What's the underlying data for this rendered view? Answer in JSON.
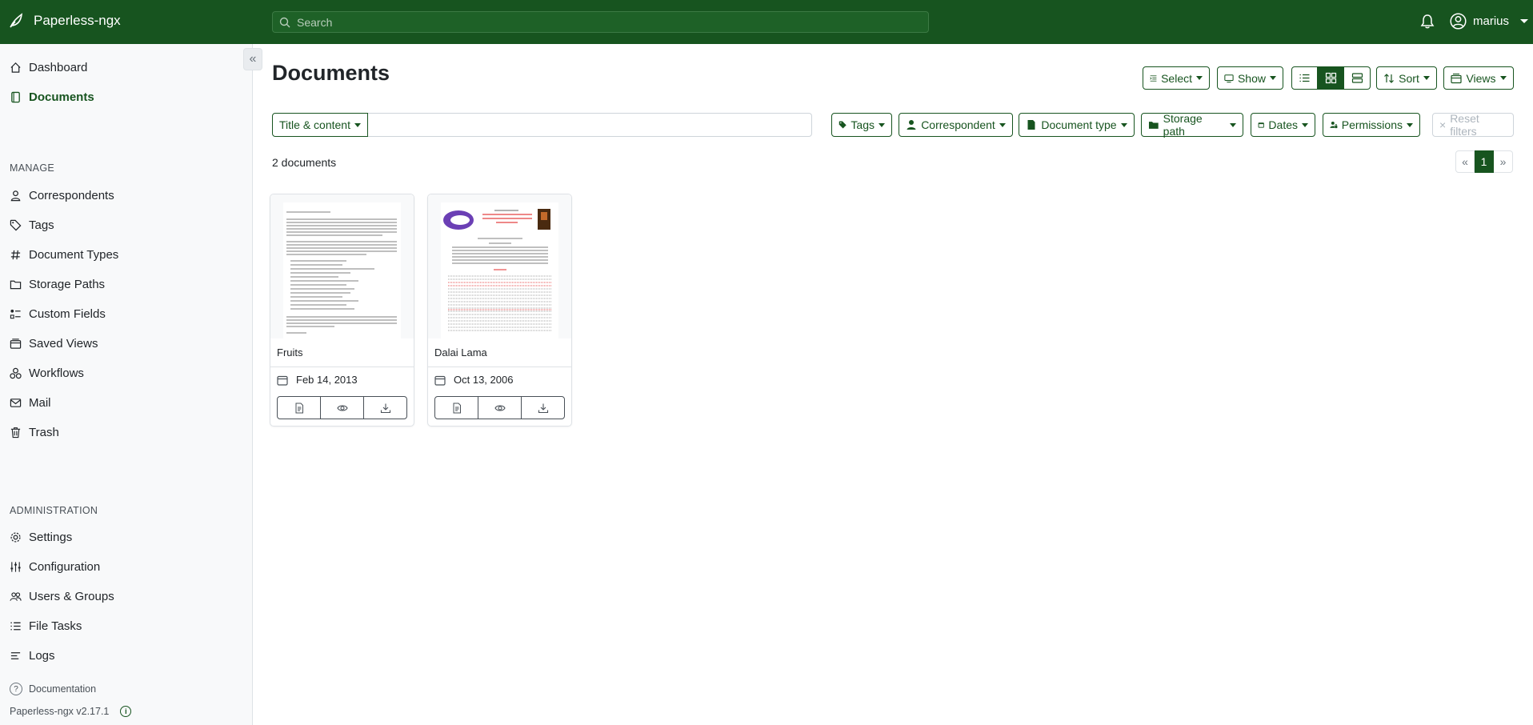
{
  "topbar": {
    "app_name": "Paperless-ngx",
    "search_placeholder": "Search",
    "username": "marius"
  },
  "sidebar": {
    "main_items": [
      {
        "label": "Dashboard",
        "icon": "house-icon"
      },
      {
        "label": "Documents",
        "icon": "file-icon",
        "active": true
      }
    ],
    "manage_label": "MANAGE",
    "manage_items": [
      {
        "label": "Correspondents",
        "icon": "person-icon"
      },
      {
        "label": "Tags",
        "icon": "tag-icon"
      },
      {
        "label": "Document Types",
        "icon": "hash-icon"
      },
      {
        "label": "Storage Paths",
        "icon": "folder-icon"
      },
      {
        "label": "Custom Fields",
        "icon": "ui-radios-icon"
      },
      {
        "label": "Saved Views",
        "icon": "window-stack-icon"
      },
      {
        "label": "Workflows",
        "icon": "boxes-icon"
      },
      {
        "label": "Mail",
        "icon": "envelope-icon"
      },
      {
        "label": "Trash",
        "icon": "trash-icon"
      }
    ],
    "admin_label": "ADMINISTRATION",
    "admin_items": [
      {
        "label": "Settings",
        "icon": "gear-icon"
      },
      {
        "label": "Configuration",
        "icon": "sliders-icon"
      },
      {
        "label": "Users & Groups",
        "icon": "people-icon"
      },
      {
        "label": "File Tasks",
        "icon": "list-task-icon"
      },
      {
        "label": "Logs",
        "icon": "text-left-icon"
      }
    ],
    "documentation": "Documentation",
    "version": "Paperless-ngx v2.17.1"
  },
  "main": {
    "title": "Documents",
    "toolbar": {
      "select": "Select",
      "show": "Show",
      "sort": "Sort",
      "views": "Views"
    },
    "filters": {
      "text_mode": "Title & content",
      "text_value": "",
      "tags": "Tags",
      "correspondent": "Correspondent",
      "document_type": "Document type",
      "storage_path": "Storage path",
      "dates": "Dates",
      "permissions": "Permissions",
      "reset": "Reset filters"
    },
    "doc_count": "2 documents",
    "pager": {
      "prev": "«",
      "current": "1",
      "next": "»"
    },
    "documents": [
      {
        "title": "Fruits",
        "date": "Feb 14, 2013"
      },
      {
        "title": "Dalai Lama",
        "date": "Oct 13, 2006"
      }
    ]
  },
  "colors": {
    "brand": "#17541f",
    "sidebar_bg": "#f8f9fa"
  }
}
